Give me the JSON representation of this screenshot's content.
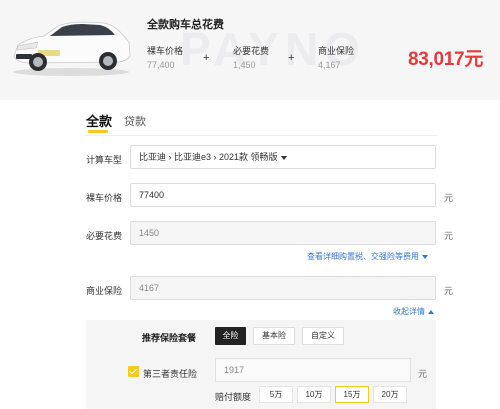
{
  "summary": {
    "title": "全款购车总花费",
    "watermark": "PAYNO",
    "stats": [
      {
        "label": "裸车价格",
        "value": "77,400"
      },
      {
        "label": "必要花费",
        "value": "1,450"
      },
      {
        "label": "商业保险",
        "value": "4,167"
      }
    ],
    "plus": "+",
    "total": "83,017元"
  },
  "tabs": [
    {
      "label": "全款",
      "active": true
    },
    {
      "label": "贷款",
      "active": false
    }
  ],
  "form": {
    "model": {
      "label": "计算车型",
      "value": "比亚迪 › 比亚迪e3 › 2021款 领畅版"
    },
    "price": {
      "label": "裸车价格",
      "value": "77400",
      "unit": "元"
    },
    "fees": {
      "label": "必要花费",
      "value": "1450",
      "unit": "元",
      "detail_link": "查看详细购置税、交强险等费用"
    },
    "insurance": {
      "label": "商业保险",
      "value": "4167",
      "unit": "元",
      "collapse_link": "收起详情"
    }
  },
  "package": {
    "label": "推荐保险套餐",
    "options": [
      {
        "label": "全险",
        "active": true
      },
      {
        "label": "基本险",
        "active": false
      },
      {
        "label": "自定义",
        "active": false
      }
    ],
    "third_party": {
      "label": "第三者责任险",
      "checked": true,
      "value": "1917",
      "unit": "元"
    },
    "coverage": {
      "label": "赔付额度",
      "amounts": [
        {
          "label": "5万",
          "active": false
        },
        {
          "label": "10万",
          "active": false
        },
        {
          "label": "15万",
          "active": true
        },
        {
          "label": "20万",
          "active": false
        }
      ]
    }
  },
  "colors": {
    "accent": "#f5cb1d",
    "total": "#e4393c",
    "link": "#3278d6"
  }
}
